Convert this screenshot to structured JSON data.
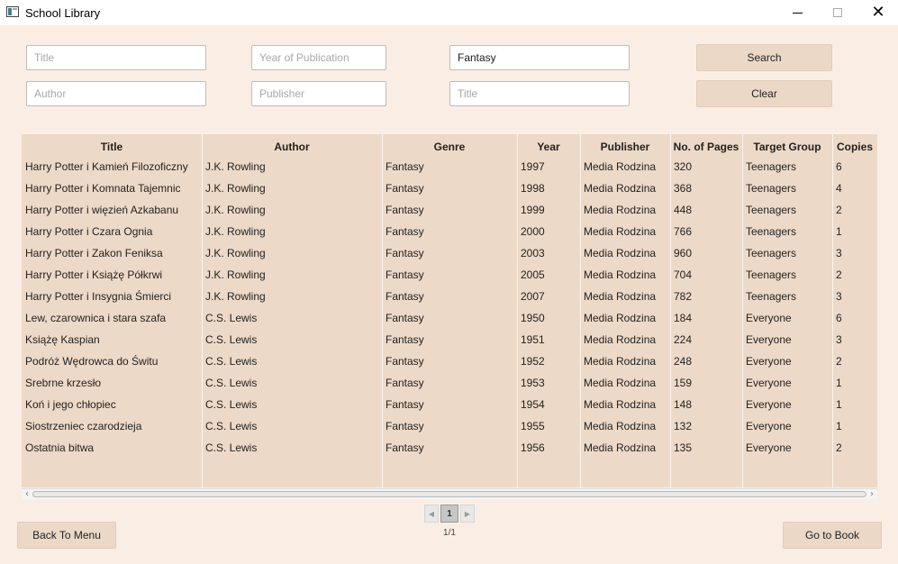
{
  "window": {
    "title": "School Library",
    "minimize": "—",
    "maximize": "□",
    "close": "✕"
  },
  "search_form": {
    "title1": {
      "value": "",
      "placeholder": "Title"
    },
    "author": {
      "value": "",
      "placeholder": "Author"
    },
    "year": {
      "value": "",
      "placeholder": "Year of Publication"
    },
    "publisher": {
      "value": "",
      "placeholder": "Publisher"
    },
    "genre": {
      "value": "Fantasy",
      "placeholder": ""
    },
    "title2": {
      "value": "",
      "placeholder": "Title"
    },
    "search_label": "Search",
    "clear_label": "Clear"
  },
  "table": {
    "headers": [
      "Title",
      "Author",
      "Genre",
      "Year",
      "Publisher",
      "No. of Pages",
      "Target Group",
      "Copies"
    ],
    "rows": [
      [
        "Harry Potter i Kamień Filozoficzny",
        "J.K. Rowling",
        "Fantasy",
        "1997",
        "Media Rodzina",
        "320",
        "Teenagers",
        "6"
      ],
      [
        "Harry Potter i Komnata Tajemnic",
        "J.K. Rowling",
        "Fantasy",
        "1998",
        "Media Rodzina",
        "368",
        "Teenagers",
        "4"
      ],
      [
        "Harry Potter i więzień Azkabanu",
        "J.K. Rowling",
        "Fantasy",
        "1999",
        "Media Rodzina",
        "448",
        "Teenagers",
        "2"
      ],
      [
        "Harry Potter i Czara Ognia",
        "J.K. Rowling",
        "Fantasy",
        "2000",
        "Media Rodzina",
        "766",
        "Teenagers",
        "1"
      ],
      [
        "Harry Potter i Zakon Feniksa",
        "J.K. Rowling",
        "Fantasy",
        "2003",
        "Media Rodzina",
        "960",
        "Teenagers",
        "3"
      ],
      [
        "Harry Potter i Książę Półkrwi",
        "J.K. Rowling",
        "Fantasy",
        "2005",
        "Media Rodzina",
        "704",
        "Teenagers",
        "2"
      ],
      [
        "Harry Potter i Insygnia Śmierci",
        "J.K. Rowling",
        "Fantasy",
        "2007",
        "Media Rodzina",
        "782",
        "Teenagers",
        "3"
      ],
      [
        "Lew, czarownica i stara szafa",
        "C.S. Lewis",
        "Fantasy",
        "1950",
        "Media Rodzina",
        "184",
        "Everyone",
        "6"
      ],
      [
        "Książę Kaspian",
        "C.S. Lewis",
        "Fantasy",
        "1951",
        "Media Rodzina",
        "224",
        "Everyone",
        "3"
      ],
      [
        "Podróż Wędrowca do Świtu",
        "C.S. Lewis",
        "Fantasy",
        "1952",
        "Media Rodzina",
        "248",
        "Everyone",
        "2"
      ],
      [
        "Srebrne krzesło",
        "C.S. Lewis",
        "Fantasy",
        "1953",
        "Media Rodzina",
        "159",
        "Everyone",
        "1"
      ],
      [
        "Koń i jego chłopiec",
        "C.S. Lewis",
        "Fantasy",
        "1954",
        "Media Rodzina",
        "148",
        "Everyone",
        "1"
      ],
      [
        "Siostrzeniec czarodzieja",
        "C.S. Lewis",
        "Fantasy",
        "1955",
        "Media Rodzina",
        "132",
        "Everyone",
        "1"
      ],
      [
        "Ostatnia bitwa",
        "C.S. Lewis",
        "Fantasy",
        "1956",
        "Media Rodzina",
        "135",
        "Everyone",
        "2"
      ]
    ]
  },
  "pagination": {
    "prev": "◀",
    "page": "1",
    "next": "▶",
    "info": "1/1"
  },
  "footer": {
    "back_label": "Back To Menu",
    "go_label": "Go to Book"
  },
  "scrollbar": {
    "left": "‹",
    "right": "›"
  }
}
